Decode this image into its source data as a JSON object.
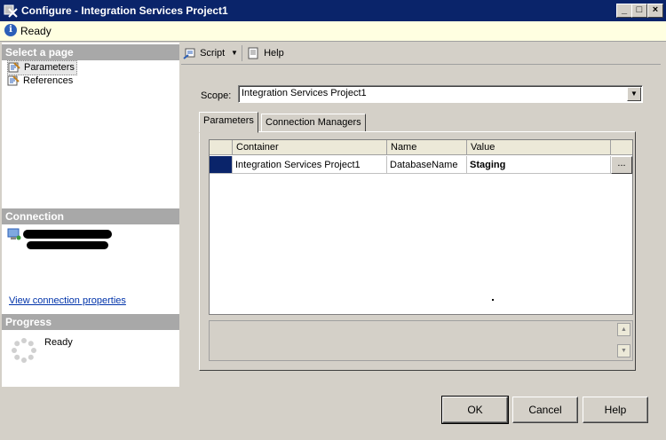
{
  "window": {
    "title": "Configure - Integration Services Project1",
    "min_icon": "minimize-icon",
    "max_icon": "maximize-icon",
    "close_icon": "close-icon"
  },
  "status": {
    "text": "Ready",
    "icon": "info-icon"
  },
  "left": {
    "select_page_header": "Select a page",
    "pages": [
      {
        "label": "Parameters",
        "icon": "page-icon"
      },
      {
        "label": "References",
        "icon": "page-icon"
      }
    ],
    "connection_header": "Connection",
    "view_connection_link": "View connection properties",
    "progress_header": "Progress",
    "progress_status": "Ready"
  },
  "toolbar": {
    "script_label": "Script",
    "help_label": "Help"
  },
  "scope": {
    "label": "Scope:",
    "value": "Integration Services Project1"
  },
  "tabs": [
    {
      "label": "Parameters"
    },
    {
      "label": "Connection Managers"
    }
  ],
  "grid": {
    "columns": [
      "Container",
      "Name",
      "Value"
    ],
    "rows": [
      {
        "container": "Integration Services Project1",
        "name": "DatabaseName",
        "value": "Staging",
        "edit_label": "..."
      }
    ]
  },
  "buttons": {
    "ok": "OK",
    "cancel": "Cancel",
    "help": "Help"
  },
  "colors": {
    "titlebar": "#0a246a",
    "status_bg": "#ffffe1",
    "link": "#0033aa"
  }
}
